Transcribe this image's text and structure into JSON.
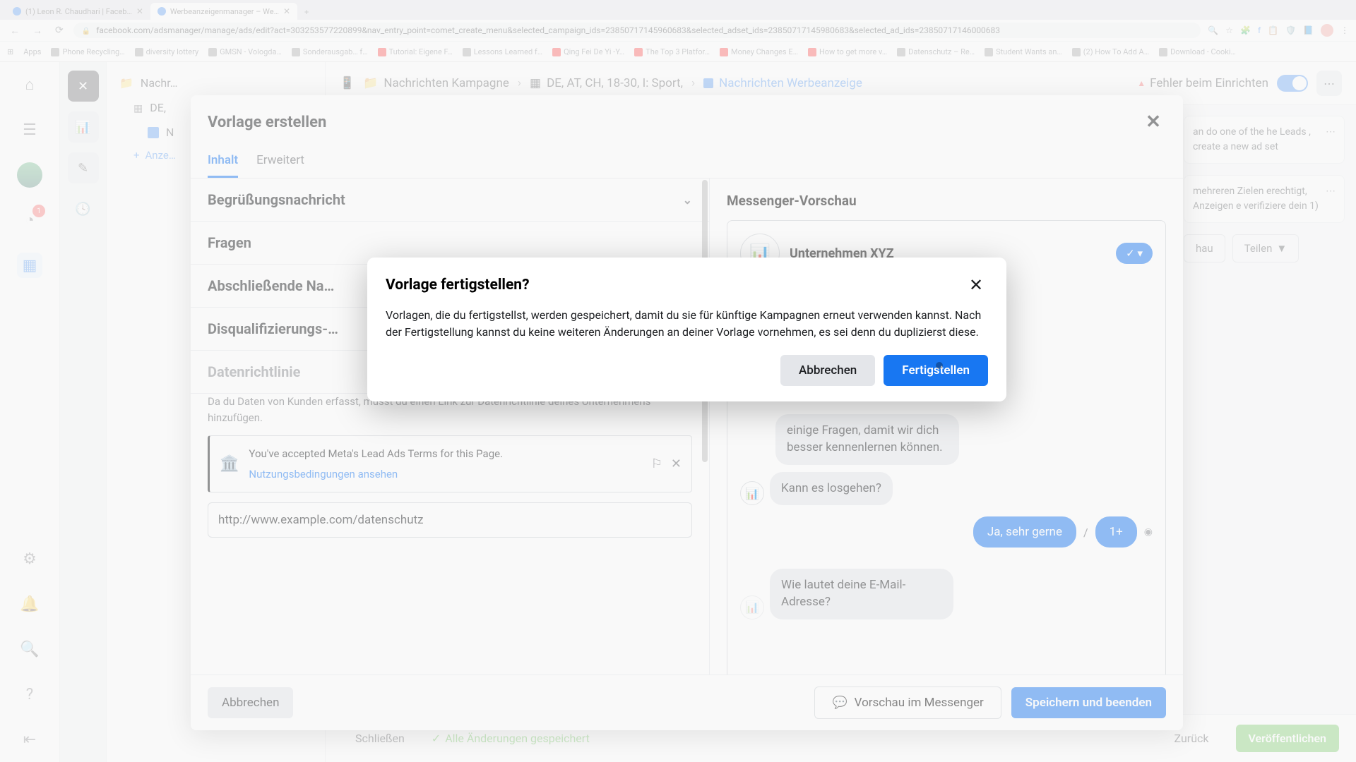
{
  "browser": {
    "tabs": [
      {
        "title": "(1) Leon R. Chaudhari | Faceb…"
      },
      {
        "title": "Werbeanzeigenmanager – We…"
      }
    ],
    "url": "facebook.com/adsmanager/manage/ads/edit?act=303253577220899&nav_entry_point=comet_create_menu&selected_campaign_ids=23850717145960683&selected_adset_ids=23850717145980683&selected_ad_ids=23850717146000683",
    "bookmarks": [
      "Apps",
      "Phone Recycling…",
      "diversity lottery",
      "GMSN - Vologda…",
      "Sonderausgab… f…",
      "Tutorial: Eigene F…",
      "Lessons Learned f…",
      "Qing Fei De Yi -Y…",
      "The Top 3 Platfor…",
      "Money Changes E…",
      "How to get more v…",
      "Datenschutz – Re…",
      "Student Wants an…",
      "(2) How To Add A…",
      "Download - Cooki…"
    ]
  },
  "leftnav": {
    "notif_count": "1"
  },
  "tree": {
    "folder": "Nachr…",
    "grid_row": "DE,",
    "file": "N",
    "add": "Anze…"
  },
  "breadcrumbs": {
    "campaign": "Nachrichten Kampagne",
    "adset": "DE, AT, CH, 18-30, I: Sport,",
    "ad": "Nachrichten Werbeanzeige",
    "error": "Fehler beim Einrichten"
  },
  "right_cards": {
    "card1": "an do one of the he Leads , create a new ad set",
    "card2": "mehreren Zielen erechtigt, Anzeigen e verifiziere dein 1)",
    "preview_btn": "hau",
    "share_btn": "Teilen"
  },
  "bottombar": {
    "close": "Schließen",
    "saved": "Alle Änderungen gespeichert",
    "back": "Zurück",
    "publish": "Veröffentlichen"
  },
  "modal1": {
    "title": "Vorlage erstellen",
    "tab_content": "Inhalt",
    "tab_advanced": "Erweitert",
    "sec_greeting": "Begrüßungsnachricht",
    "sec_questions": "Fragen",
    "sec_closing": "Abschließende Na…",
    "sec_disqual": "Disqualifizierungs-…",
    "sec_privacy": "Datenrichtlinie",
    "privacy_desc": "Da du Daten von Kunden erfasst, musst du einen Link zur Datenrichtlinie deines Unternehmens hinzufügen.",
    "info_text": "You've accepted Meta's Lead Ads Terms for this Page.",
    "info_link": "Nutzungsbedingungen ansehen",
    "url_value": "http://www.example.com/datenschutz",
    "preview_title": "Messenger-Vorschau",
    "company": "Unternehmen XYZ",
    "checkmark": "✓ ▾",
    "bubble1": "einige Fragen, damit wir dich besser kennenlernen können.",
    "bubble2": "Kann es losgehen?",
    "reply1": "Ja, sehr gerne",
    "reply2": "1+",
    "bubble3": "Wie lautet deine E-Mail-Adresse?",
    "cancel": "Abbrechen",
    "preview_btn": "Vorschau im Messenger",
    "save": "Speichern und beenden"
  },
  "modal2": {
    "title": "Vorlage fertigstellen?",
    "body": "Vorlagen, die du fertigstellst, werden gespeichert, damit du sie für künftige Kampagnen erneut verwenden kannst. Nach der Fertigstellung kannst du keine weiteren Änderungen an deiner Vorlage vornehmen, es sei denn du duplizierst diese.",
    "cancel": "Abbrechen",
    "confirm": "Fertigstellen"
  }
}
